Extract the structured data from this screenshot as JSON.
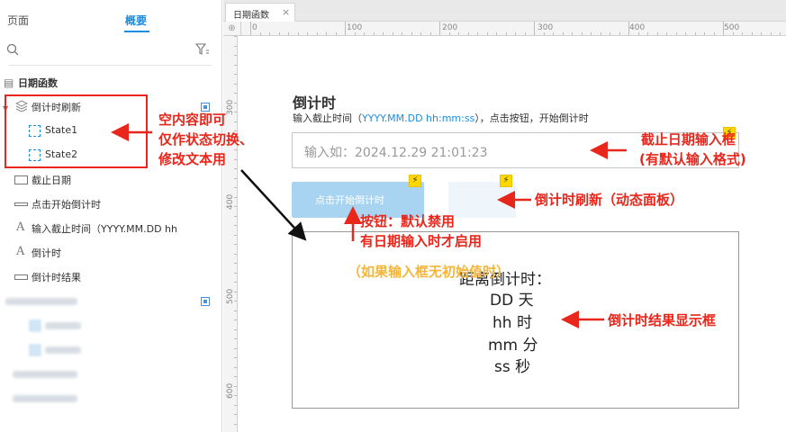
{
  "left_panel": {
    "tabs": [
      "页面",
      "概要"
    ],
    "tree": {
      "page_name": "日期函数",
      "dynamic_panel": "倒计时刷新",
      "states": [
        "State1",
        "State2"
      ],
      "items": [
        "截止日期",
        "点击开始倒计时",
        "输入截止时间（YYYY.MM.DD hh",
        "倒计时",
        "倒计时结果"
      ]
    }
  },
  "tab": {
    "label": "日期函数",
    "close": "×"
  },
  "ruler": {
    "h_labels": [
      "0",
      "100",
      "200",
      "300",
      "400",
      "500"
    ],
    "v_labels": [
      "300",
      "400",
      "500",
      "600"
    ]
  },
  "canvas": {
    "title": "倒计时",
    "subtitle_prefix": "输入截止时间（",
    "subtitle_format": "YYYY.MM.DD hh:mm:ss",
    "subtitle_suffix": "），点击按钮，开始倒计时",
    "input_placeholder": "输入如：2024.12.29 21:01:23",
    "button_label": "点击开始倒计时",
    "result_lines": [
      "距离倒计时：",
      "DD 天",
      "hh 时",
      "mm 分",
      "ss 秒"
    ]
  },
  "annotations": {
    "empty_content": [
      "空内容即可",
      "仅作状态切换、",
      "修改文本用"
    ],
    "input_box": [
      "截止日期输入框",
      "(有默认输入格式)"
    ],
    "refresh": "倒计时刷新（动态面板）",
    "button": [
      "按钮：默认禁用",
      "有日期输入时才启用"
    ],
    "no_initial": "（如果输入框无初始值时）",
    "result_box": "倒计时结果显示框"
  },
  "colors": {
    "accent": "#1b8de0",
    "annotation_red": "#e8261b",
    "annotation_yellow": "#f3b53a",
    "button_fill": "#a8d4f2"
  }
}
